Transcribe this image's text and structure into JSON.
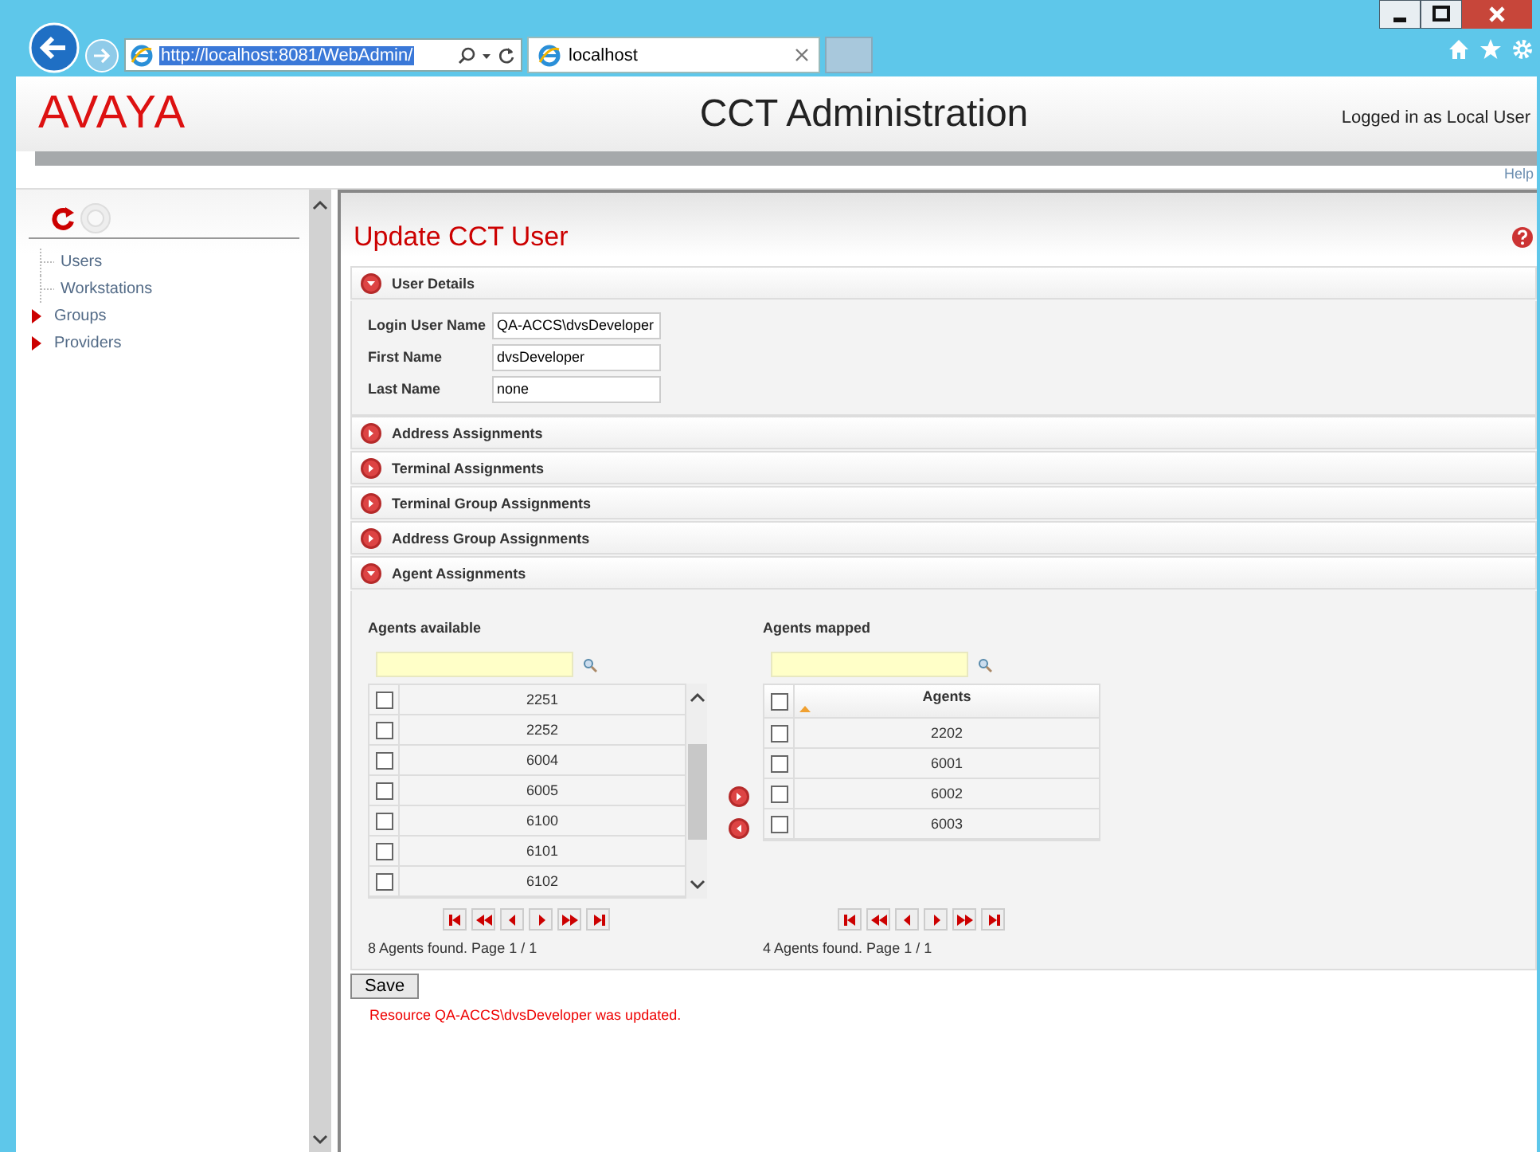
{
  "browser": {
    "address": "http://localhost:8081/WebAdmin/",
    "tab_title": "localhost"
  },
  "header": {
    "logo": "AVAYA",
    "title": "CCT Administration",
    "user": "Logged in as Local User",
    "help": "Help"
  },
  "sidebar": {
    "items": [
      {
        "label": "Users",
        "kind": "leaf"
      },
      {
        "label": "Workstations",
        "kind": "leaf"
      },
      {
        "label": "Groups",
        "kind": "folder"
      },
      {
        "label": "Providers",
        "kind": "folder"
      }
    ]
  },
  "page": {
    "title": "Update CCT User",
    "sections": [
      {
        "title": "User Details",
        "expanded": true,
        "kind": "form",
        "fields": [
          {
            "label": "Login User Name",
            "value": "QA-ACCS\\dvsDeveloper"
          },
          {
            "label": "First Name",
            "value": "dvsDeveloper"
          },
          {
            "label": "Last Name",
            "value": "none"
          }
        ]
      },
      {
        "title": "Address Assignments",
        "expanded": false
      },
      {
        "title": "Terminal Assignments",
        "expanded": false
      },
      {
        "title": "Terminal Group Assignments",
        "expanded": false
      },
      {
        "title": "Address Group Assignments",
        "expanded": false
      },
      {
        "title": "Agent Assignments",
        "expanded": true,
        "kind": "agents"
      }
    ],
    "available": {
      "title": "Agents available",
      "rows": [
        {
          "value": "2251",
          "checked": false
        },
        {
          "value": "2252",
          "checked": false
        },
        {
          "value": "6004",
          "checked": false
        },
        {
          "value": "6005",
          "checked": false
        },
        {
          "value": "6100",
          "checked": false
        },
        {
          "value": "6101",
          "checked": false
        },
        {
          "value": "6102",
          "checked": false
        }
      ],
      "status": "8 Agents found. Page 1 / 1"
    },
    "mapped": {
      "title": "Agents mapped",
      "column": "Agents",
      "select_all_checked": false,
      "rows": [
        {
          "value": "2202",
          "checked": false
        },
        {
          "value": "6001",
          "checked": false
        },
        {
          "value": "6002",
          "checked": false
        },
        {
          "value": "6003",
          "checked": false
        }
      ],
      "status": "4 Agents found. Page 1 / 1"
    },
    "save": "Save",
    "message": "Resource QA-ACCS\\dvsDeveloper was updated."
  }
}
